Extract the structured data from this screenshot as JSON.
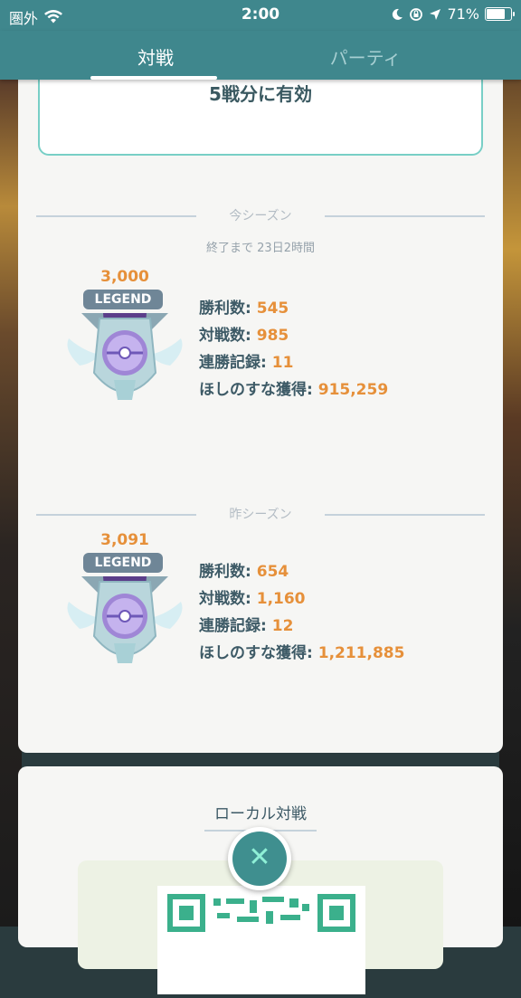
{
  "statusbar": {
    "carrier": "圏外",
    "time": "2:00",
    "battery": "71%"
  },
  "tabs": [
    {
      "label": "対戦"
    },
    {
      "label": "パーティ"
    }
  ],
  "offer": {
    "text": "5戦分に有効"
  },
  "current_season": {
    "label": "今シーズン",
    "remaining": "終了まで 23日2時間",
    "rating": "3,000",
    "rank": "LEGEND",
    "stats": [
      {
        "label": "勝利数:",
        "value": "545"
      },
      {
        "label": "対戦数:",
        "value": "985"
      },
      {
        "label": "連勝記録:",
        "value": "11"
      },
      {
        "label": "ほしのすな獲得:",
        "value": "915,259"
      }
    ]
  },
  "previous_season": {
    "label": "昨シーズン",
    "rating": "3,091",
    "rank": "LEGEND",
    "stats": [
      {
        "label": "勝利数:",
        "value": "654"
      },
      {
        "label": "対戦数:",
        "value": "1,160"
      },
      {
        "label": "連勝記録:",
        "value": "12"
      },
      {
        "label": "ほしのすな獲得:",
        "value": "1,211,885"
      }
    ]
  },
  "local_battle": {
    "title": "ローカル対戦"
  },
  "colors": {
    "teal": "#3f878d",
    "orange": "#e6903a",
    "text": "#3d5a66"
  },
  "icons": [
    "wifi-icon",
    "moon-icon",
    "rotation-lock-icon",
    "location-arrow-icon",
    "battery-icon",
    "legend-emblem-icon",
    "close-icon",
    "qr-code"
  ]
}
